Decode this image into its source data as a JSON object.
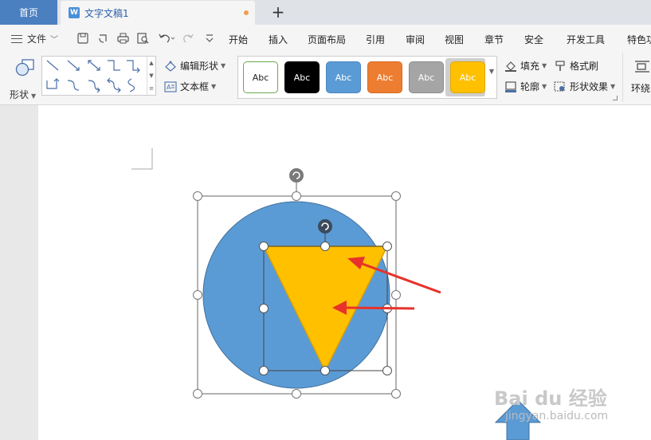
{
  "tabs": {
    "home": "首页",
    "document": "文字文稿1",
    "add": "+"
  },
  "menu": {
    "file": "文件",
    "items": [
      "开始",
      "插入",
      "页面布局",
      "引用",
      "审阅",
      "视图",
      "章节",
      "安全",
      "开发工具",
      "特色功"
    ]
  },
  "ribbon": {
    "shapes_label": "形状",
    "edit_shape": "编辑形状",
    "text_box": "文本框",
    "style_tiles": [
      {
        "label": "Abc",
        "bg": "#ffffff",
        "border": "#6aa84f",
        "fg": "#222222"
      },
      {
        "label": "Abc",
        "bg": "#000000",
        "border": "#000000",
        "fg": "#ffffff"
      },
      {
        "label": "Abc",
        "bg": "#5b9bd5",
        "border": "#4a86c0",
        "fg": "#ffffff"
      },
      {
        "label": "Abc",
        "bg": "#ed7d31",
        "border": "#d56a22",
        "fg": "#ffffff"
      },
      {
        "label": "Abc",
        "bg": "#a5a5a5",
        "border": "#8c8c8c",
        "fg": "#ffffff"
      },
      {
        "label": "Abc",
        "bg": "#ffc000",
        "border": "#e0a800",
        "fg": "#ffffff"
      }
    ],
    "fill": "填充",
    "format_painter": "格式刷",
    "outline": "轮廓",
    "shape_effects": "形状效果",
    "wrap": "环绕"
  },
  "colors": {
    "circle": "#5b9bd5",
    "triangle": "#ffc000",
    "arrow": "#e8312a",
    "accent": "#4a7fc0"
  },
  "watermark": {
    "main": "Bai du 经验",
    "sub": "jingyan.baidu.com"
  }
}
